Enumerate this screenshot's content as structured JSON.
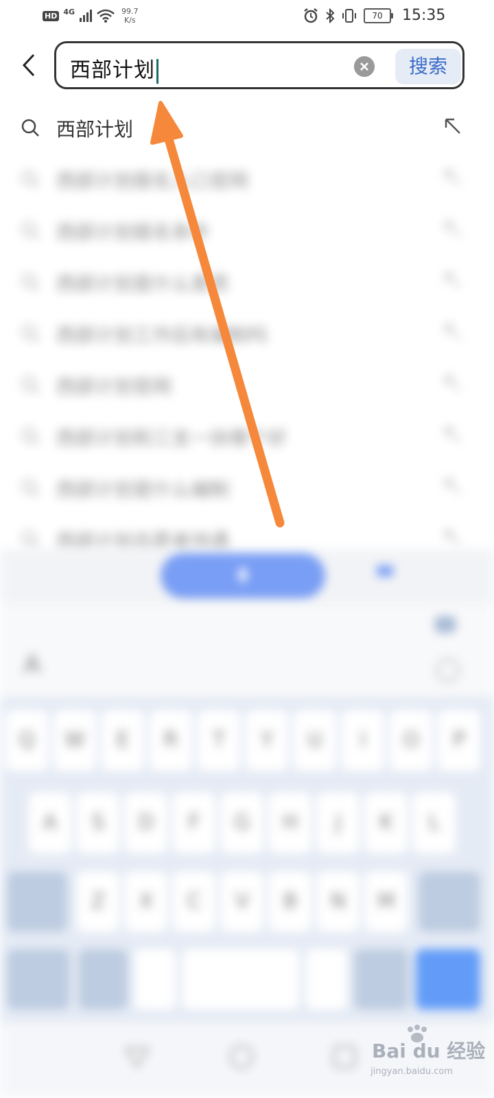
{
  "status_bar": {
    "hd": "HD",
    "network": "4G",
    "speed_value": "99.7",
    "speed_unit": "K/s",
    "battery": "70",
    "time": "15:35"
  },
  "search": {
    "query": "西部计划",
    "submit_label": "搜索"
  },
  "suggestions": [
    {
      "text": "西部计划"
    }
  ],
  "blurred_suggestions": [
    {
      "text": "西部计划报名入口官网"
    },
    {
      "text": "西部计划报名条件"
    },
    {
      "text": "西部计划是什么意思"
    },
    {
      "text": "西部计划工作后有编制吗"
    },
    {
      "text": "西部计划官网"
    },
    {
      "text": "西部计划和三支一扶哪个好"
    },
    {
      "text": "西部计划是什么编制"
    },
    {
      "text": "西部计划志愿者待遇"
    }
  ],
  "keyboard": {
    "row1": [
      "Q",
      "W",
      "E",
      "R",
      "T",
      "Y",
      "U",
      "I",
      "O",
      "P"
    ],
    "row2": [
      "A",
      "S",
      "D",
      "F",
      "G",
      "H",
      "J",
      "K",
      "L"
    ],
    "row3": [
      "Z",
      "X",
      "C",
      "V",
      "B",
      "N",
      "M"
    ]
  },
  "watermark": {
    "brand": "Bai du 经验",
    "site": "jingyan.baidu.com"
  },
  "colors": {
    "accent": "#3b6cc8",
    "arrow": "#f5883a",
    "caret": "#1c6b63"
  }
}
